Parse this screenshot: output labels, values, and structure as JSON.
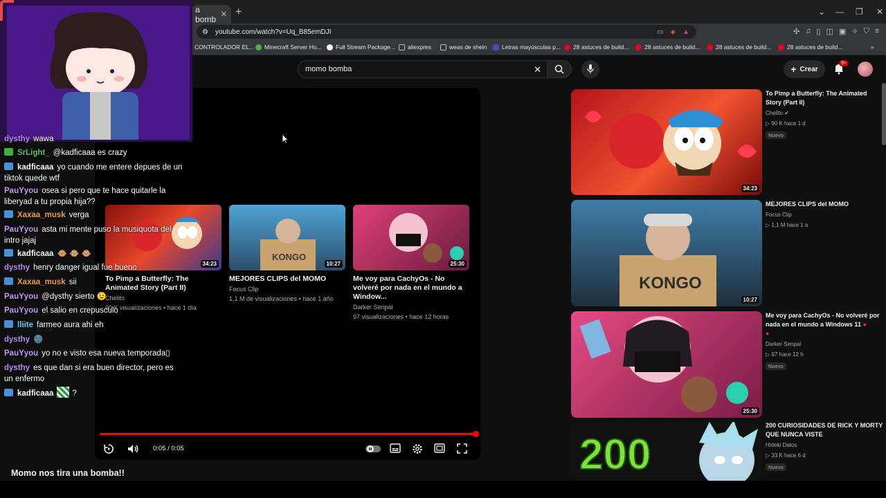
{
  "browser": {
    "tab_title": "a bomb",
    "url": "youtube.com/watch?v=Uq_B85emDJI",
    "bookmarks": [
      "CONTROLADOR EL...",
      "Minecraft Server Ho...",
      "Full Stream Package...",
      "aliexpres",
      "weas de shein",
      "Letras mayúsculas p...",
      "28 astuces de build...",
      "28 astuces de build...",
      "28 astuces de build...",
      "28 astuces de build..."
    ]
  },
  "header": {
    "search_value": "momo bomba",
    "create_label": "Crear",
    "notif_count": "9+"
  },
  "player": {
    "time": "0:05 / 0:05",
    "progress": 1.0,
    "endscreen": [
      {
        "title": "To Pimp a Butterfly: The Animated Story (Part II)",
        "channel": "Chelito",
        "meta": "90 K visualizaciones • hace 1 día",
        "duration": "34:23"
      },
      {
        "title": "MEJORES CLIPS del MOMO",
        "channel": "Focus Clip",
        "meta": "1,1 M de visualizaciones • hace 1 año",
        "duration": "10:27"
      },
      {
        "title": "Me voy para CachyOs - No volveré por nada en el mundo a Window...",
        "channel": "Darker Senpai",
        "meta": "97 visualizaciones • hace 12 horas",
        "duration": "25:30"
      }
    ]
  },
  "video_title": "Momo nos tira una bomba!!",
  "recommendations": [
    {
      "title": "To Pimp a Butterfly: The Animated Story (Part II)",
      "channel": "Chelito",
      "meta": "▷ 90 K  hace 1 d",
      "badge": "Nuevo",
      "duration": "34:23"
    },
    {
      "title": "MEJORES CLIPS del MOMO",
      "channel": "Focus Clip",
      "meta": "▷ 1,1 M  hace 1 a",
      "badge": "",
      "duration": "10:27"
    },
    {
      "title": "Me voy para CachyOs - No volveré por nada en el mundo a Windows 11",
      "channel": "Darker Senpai",
      "meta": "▷ 97  hace 12 h",
      "badge": "Nuevo",
      "duration": "25:30"
    },
    {
      "title": "200 CURIOSIDADES DE RICK Y MORTY QUE NUNCA VISTE",
      "channel": "Hideki Datos",
      "meta": "▷ 33 K  hace 6 d",
      "badge": "Nuevo",
      "duration": ""
    }
  ],
  "chat": [
    {
      "user": "dysthy",
      "text": "wawa",
      "color": "#b48cf2",
      "badge": ""
    },
    {
      "user": "SrLight_",
      "text": "@kadficaaa es crazy",
      "color": "#5fbf5f",
      "badge": "#3cb043"
    },
    {
      "user": "kadficaaa",
      "text": "yo cuando me entere depues de un tiktok quede wtf",
      "color": "#ffffff",
      "badge": "#4a90d9"
    },
    {
      "user": "PauYyou",
      "text": "osea si pero que te hace quitarle la liberyad a tu propia hija??",
      "color": "#c59af5",
      "badge": ""
    },
    {
      "user": "Xaxaa_musk",
      "text": "verga",
      "color": "#f0a030",
      "badge": "#4a90d9"
    },
    {
      "user": "PauYyou",
      "text": "asta mi mente puso la musiquota del intro jajaj",
      "color": "#c59af5",
      "badge": ""
    },
    {
      "user": "kadficaaa",
      "text": "🐵 🐵 🐵",
      "color": "#ffffff",
      "badge": "#4a90d9"
    },
    {
      "user": "dysthy",
      "text": "henry danger igual fue bueno",
      "color": "#b48cf2",
      "badge": ""
    },
    {
      "user": "Xaxaa_musk",
      "text": "sii",
      "color": "#f0a030",
      "badge": "#4a90d9"
    },
    {
      "user": "PauYyou",
      "text": "@dysthy sierto 😉",
      "color": "#c59af5",
      "badge": ""
    },
    {
      "user": "PauYyou",
      "text": "el salio en crepusculo",
      "color": "#c59af5",
      "badge": ""
    },
    {
      "user": "lliite",
      "text": "farmeo aura ahi eh",
      "color": "#5fd0f0",
      "badge": "#4a90d9"
    },
    {
      "user": "dysthy",
      "text": "🌚",
      "color": "#b48cf2",
      "badge": ""
    },
    {
      "user": "PauYyou",
      "text": "yo no e visto esa nueva temporada▯",
      "color": "#c59af5",
      "badge": ""
    },
    {
      "user": "dysthy",
      "text": "es que dan si era buen director, pero es un enfermo",
      "color": "#b48cf2",
      "badge": ""
    },
    {
      "user": "kadficaaa",
      "text": "?",
      "color": "#ffffff",
      "badge": "#4a90d9"
    }
  ]
}
